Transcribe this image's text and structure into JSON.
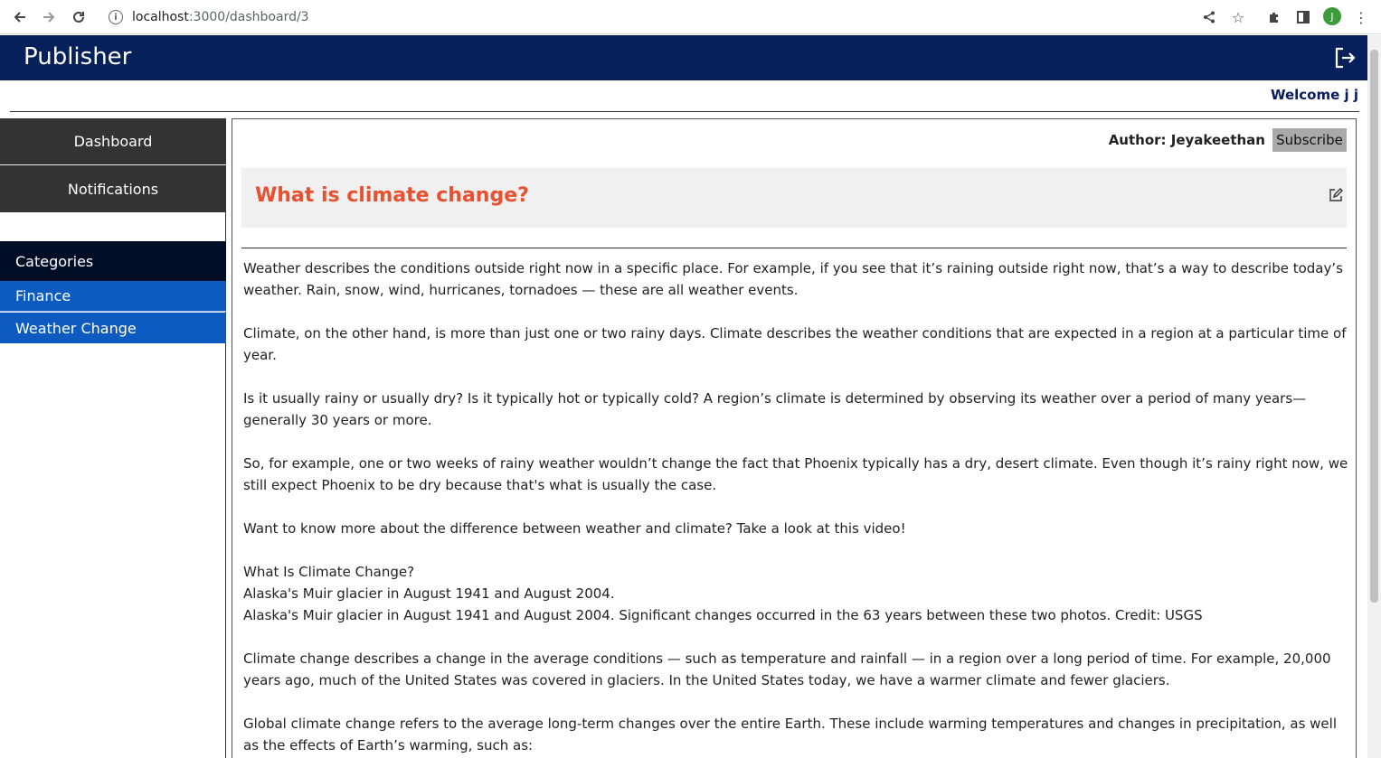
{
  "browser": {
    "url_host": "localhost",
    "url_path": ":3000/dashboard/3",
    "avatar_letter": "J"
  },
  "header": {
    "brand": "Publisher",
    "welcome": "Welcome j j",
    "brand_color": "#05205a"
  },
  "sidebar": {
    "nav": [
      {
        "label": "Dashboard"
      },
      {
        "label": "Notifications"
      }
    ],
    "categories_title": "Categories",
    "categories": [
      {
        "label": "Finance"
      },
      {
        "label": "Weather Change"
      }
    ]
  },
  "article": {
    "author": "Author: Jeyakeethan",
    "subscribe_label": "Subscribe",
    "title": "What is climate change?",
    "paragraphs": [
      "Weather describes the conditions outside right now in a specific place. For example, if you see that it’s raining outside right now, that’s a way to describe today’s weather. Rain, snow, wind, hurricanes, tornadoes — these are all weather events.",
      "Climate, on the other hand, is more than just one or two rainy days. Climate describes the weather conditions that are expected in a region at a particular time of year.",
      "Is it usually rainy or usually dry? Is it typically hot or typically cold? A region’s climate is determined by observing its weather over a period of many years—generally 30 years or more.",
      "So, for example, one or two weeks of rainy weather wouldn’t change the fact that Phoenix typically has a dry, desert climate. Even though it’s rainy right now, we still expect Phoenix to be dry because that's what is usually the case.",
      "Want to know more about the difference between weather and climate? Take a look at this video!",
      "What Is Climate Change?\nAlaska's Muir glacier in August 1941 and August 2004.\nAlaska's Muir glacier in August 1941 and August 2004. Significant changes occurred in the 63 years between these two photos. Credit: USGS",
      "Climate change describes a change in the average conditions — such as temperature and rainfall — in a region over a long period of time. For example, 20,000 years ago, much of the United States was covered in glaciers. In the United States today, we have a warmer climate and fewer glaciers.",
      "Global climate change refers to the average long-term changes over the entire Earth. These include warming temperatures and changes in precipitation, as well as the effects of Earth’s warming, such as:"
    ]
  }
}
